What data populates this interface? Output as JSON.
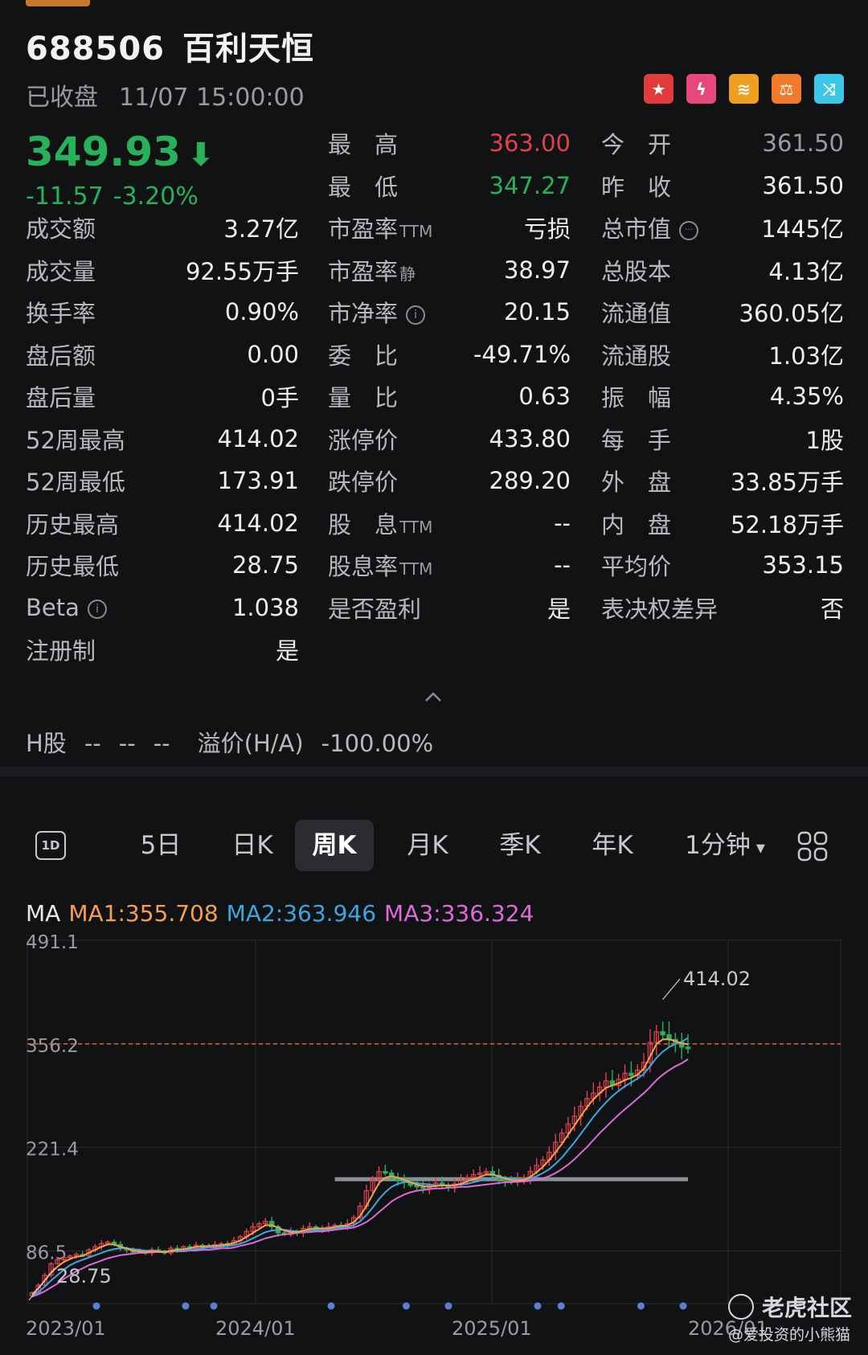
{
  "stock": {
    "code": "688506",
    "name": "百利天恒",
    "status": "已收盘",
    "datetime": "11/07 15:00:00",
    "price": "349.93",
    "change": "-11.57",
    "change_pct": "-3.20%"
  },
  "badges": [
    {
      "icon": "china-flag-icon",
      "color": "#e23b3b",
      "glyph": "★"
    },
    {
      "icon": "lightning-icon",
      "color": "#e8477a",
      "glyph": "ϟ"
    },
    {
      "icon": "coins-icon",
      "color": "#f0a020",
      "glyph": "≋"
    },
    {
      "icon": "scale-icon",
      "color": "#f07b2a",
      "glyph": "⚖"
    },
    {
      "icon": "shuffle-icon",
      "color": "#3cc8e8",
      "glyph": "⤨"
    }
  ],
  "stats": {
    "col1": [
      {
        "label": "成交额",
        "value": "3.27亿"
      },
      {
        "label": "成交量",
        "value": "92.55万手"
      },
      {
        "label": "换手率",
        "value": "0.90%"
      },
      {
        "label": "盘后额",
        "value": "0.00"
      },
      {
        "label": "盘后量",
        "value": "0手"
      },
      {
        "label": "52周最高",
        "value": "414.02"
      },
      {
        "label": "52周最低",
        "value": "173.91"
      },
      {
        "label": "历史最高",
        "value": "414.02"
      },
      {
        "label": "历史最低",
        "value": "28.75"
      },
      {
        "label": "Beta",
        "value": "1.038"
      },
      {
        "label": "注册制",
        "value": "是"
      }
    ],
    "col2": [
      {
        "label": "最　高",
        "value": "363.00"
      },
      {
        "label": "最　低",
        "value": "347.27"
      },
      {
        "label": "市盈率",
        "suffix": "TTM",
        "value": "亏损"
      },
      {
        "label": "市盈率",
        "suffix": "静",
        "value": "38.97"
      },
      {
        "label": "市净率",
        "value": "20.15"
      },
      {
        "label": "委　比",
        "value": "-49.71%"
      },
      {
        "label": "量　比",
        "value": "0.63"
      },
      {
        "label": "涨停价",
        "value": "433.80"
      },
      {
        "label": "跌停价",
        "value": "289.20"
      },
      {
        "label": "股　息",
        "suffix": "TTM",
        "value": "--"
      },
      {
        "label": "股息率",
        "suffix": "TTM",
        "value": "--"
      },
      {
        "label": "是否盈利",
        "value": "是"
      }
    ],
    "col3": [
      {
        "label": "今　开",
        "value": "361.50"
      },
      {
        "label": "昨　收",
        "value": "361.50"
      },
      {
        "label": "总市值",
        "value": "1445亿"
      },
      {
        "label": "总股本",
        "value": "4.13亿"
      },
      {
        "label": "流通值",
        "value": "360.05亿"
      },
      {
        "label": "流通股",
        "value": "1.03亿"
      },
      {
        "label": "振　幅",
        "value": "4.35%"
      },
      {
        "label": "每　手",
        "value": "1股"
      },
      {
        "label": "外　盘",
        "value": "33.85万手"
      },
      {
        "label": "内　盘",
        "value": "52.18万手"
      },
      {
        "label": "平均价",
        "value": "353.15"
      },
      {
        "label": "表决权差异",
        "value": "否"
      }
    ]
  },
  "info_icon_glyph": "i",
  "more_icon_glyph": "···",
  "hshare": {
    "label": "H股",
    "v1": "--",
    "v2": "--",
    "v3": "--",
    "premium_label": "溢价(H/A)",
    "premium_value": "-100.00%"
  },
  "tabs": {
    "icon_1d": "1D",
    "items": [
      "5日",
      "日K",
      "周K",
      "月K",
      "季K",
      "年K",
      "1分钟"
    ],
    "active": "周K"
  },
  "ma_legend": {
    "label": "MA",
    "ma1": "MA1:355.708",
    "ma2": "MA2:363.946",
    "ma3": "MA3:336.324"
  },
  "colors": {
    "up": "#e2404c",
    "down": "#27b25a",
    "ma1": "#f5a14a",
    "ma2": "#3aa7e0",
    "ma3": "#dd6ad8",
    "ref_line": "#e0632e"
  },
  "chart_data": {
    "type": "candlestick",
    "x_labels": [
      "2023/01",
      "2024/01",
      "2025/01",
      "2026/01"
    ],
    "y_ticks": [
      "491.1",
      "356.2",
      "221.4",
      "86.5"
    ],
    "ylim": [
      18,
      491.1
    ],
    "ref_value": 356.2,
    "high_annotation": "414.02",
    "low_annotation": "28.75",
    "support_level": 180,
    "close": [
      32,
      42,
      55,
      70,
      75,
      78,
      80,
      82,
      80,
      88,
      92,
      96,
      98,
      95,
      90,
      88,
      85,
      86,
      84,
      88,
      86,
      84,
      90,
      88,
      92,
      90,
      94,
      93,
      92,
      95,
      96,
      95,
      100,
      105,
      112,
      118,
      122,
      125,
      118,
      110,
      108,
      112,
      110,
      116,
      118,
      114,
      116,
      118,
      120,
      118,
      122,
      130,
      145,
      165,
      180,
      190,
      188,
      182,
      178,
      176,
      172,
      170,
      168,
      172,
      175,
      172,
      170,
      174,
      178,
      182,
      186,
      188,
      190,
      185,
      180,
      178,
      176,
      180,
      182,
      190,
      198,
      205,
      215,
      228,
      240,
      252,
      262,
      275,
      285,
      292,
      300,
      308,
      302,
      310,
      318,
      315,
      322,
      332,
      358,
      372,
      368,
      362,
      358,
      352,
      349.93
    ],
    "ma1": [
      30,
      38,
      48,
      58,
      66,
      72,
      76,
      79,
      80,
      84,
      88,
      92,
      95,
      95,
      92,
      90,
      87,
      86,
      85,
      86,
      86,
      85,
      87,
      88,
      89,
      90,
      92,
      92,
      93,
      93,
      94,
      95,
      97,
      100,
      105,
      110,
      115,
      120,
      120,
      117,
      113,
      111,
      111,
      113,
      115,
      116,
      116,
      116,
      118,
      119,
      120,
      124,
      132,
      145,
      160,
      175,
      182,
      184,
      182,
      179,
      176,
      173,
      171,
      170,
      171,
      172,
      172,
      172,
      174,
      177,
      180,
      183,
      186,
      186,
      184,
      181,
      179,
      178,
      179,
      183,
      189,
      196,
      205,
      215,
      226,
      238,
      250,
      262,
      274,
      284,
      292,
      299,
      302,
      305,
      309,
      312,
      316,
      324,
      340,
      356,
      362,
      362,
      360,
      357,
      355.7
    ],
    "ma2": [
      28,
      33,
      40,
      48,
      55,
      62,
      68,
      72,
      75,
      78,
      81,
      84,
      87,
      89,
      90,
      90,
      89,
      88,
      87,
      87,
      86,
      86,
      86,
      87,
      87,
      88,
      89,
      90,
      91,
      91,
      92,
      93,
      94,
      96,
      99,
      103,
      107,
      111,
      113,
      114,
      114,
      113,
      112,
      112,
      113,
      114,
      114,
      115,
      116,
      117,
      118,
      120,
      125,
      133,
      143,
      154,
      163,
      170,
      174,
      176,
      176,
      175,
      174,
      173,
      172,
      172,
      172,
      172,
      173,
      174,
      176,
      178,
      180,
      182,
      182,
      182,
      181,
      180,
      180,
      181,
      184,
      188,
      193,
      200,
      208,
      218,
      228,
      239,
      250,
      261,
      271,
      280,
      288,
      295,
      301,
      306,
      311,
      317,
      327,
      338,
      346,
      352,
      356,
      359,
      363.9
    ],
    "ma3": [
      27,
      30,
      34,
      39,
      44,
      50,
      55,
      60,
      64,
      68,
      71,
      74,
      77,
      79,
      81,
      82,
      83,
      84,
      84,
      85,
      85,
      85,
      86,
      86,
      86,
      87,
      87,
      88,
      88,
      89,
      90,
      90,
      91,
      93,
      95,
      97,
      100,
      103,
      105,
      107,
      108,
      109,
      110,
      111,
      111,
      112,
      112,
      113,
      114,
      115,
      116,
      117,
      120,
      124,
      130,
      137,
      144,
      151,
      156,
      160,
      163,
      165,
      166,
      167,
      168,
      168,
      169,
      169,
      170,
      170,
      171,
      172,
      173,
      174,
      175,
      176,
      176,
      177,
      177,
      178,
      179,
      181,
      184,
      188,
      193,
      199,
      206,
      214,
      222,
      231,
      240,
      248,
      256,
      264,
      271,
      278,
      285,
      292,
      300,
      309,
      316,
      322,
      327,
      331,
      336.3
    ],
    "event_markers": [
      15,
      34,
      40,
      65,
      81,
      90,
      109,
      114,
      131,
      140
    ]
  }
}
